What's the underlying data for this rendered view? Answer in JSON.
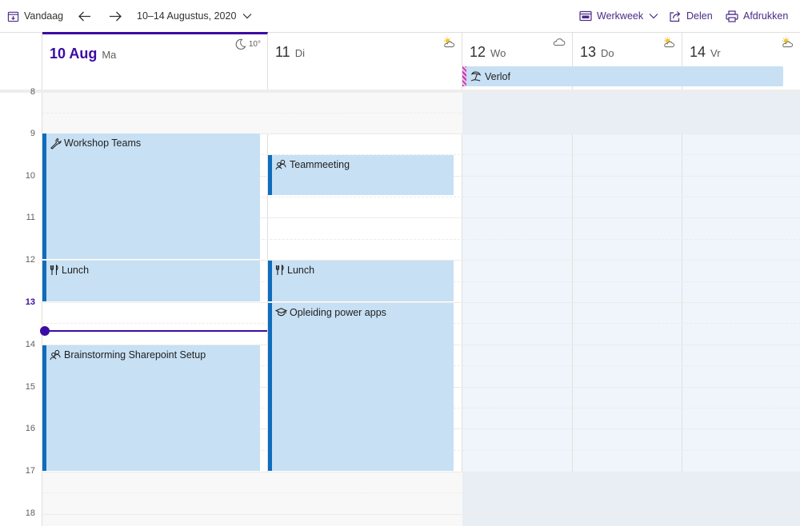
{
  "toolbar": {
    "today_label": "Vandaag",
    "date_range": "10–14 Augustus, 2020",
    "view_label": "Werkweek",
    "share_label": "Delen",
    "print_label": "Afdrukken"
  },
  "days": [
    {
      "num": "10 Aug",
      "name": "Ma",
      "weather_icon": "moon-icon",
      "temp": "10°"
    },
    {
      "num": "11",
      "name": "Di",
      "weather_icon": "partly-sunny-icon"
    },
    {
      "num": "12",
      "name": "Wo",
      "weather_icon": "cloud-icon"
    },
    {
      "num": "13",
      "name": "Do",
      "weather_icon": "partly-sunny-icon"
    },
    {
      "num": "14",
      "name": "Vr",
      "weather_icon": "partly-sunny-icon"
    }
  ],
  "allday_event": {
    "title": "Verlof",
    "icon": "beach-icon"
  },
  "hours": [
    "8",
    "9",
    "10",
    "11",
    "12",
    "13",
    "14",
    "15",
    "16",
    "17",
    "18"
  ],
  "events": {
    "workshop": {
      "title": "Workshop Teams",
      "icon": "wrench-icon"
    },
    "lunch_mon": {
      "title": "Lunch",
      "icon": "cutlery-icon"
    },
    "brainstorm": {
      "title": "Brainstorming Sharepoint Setup",
      "icon": "people-icon"
    },
    "teammeeting": {
      "title": "Teammeeting",
      "icon": "people-icon"
    },
    "lunch_tue": {
      "title": "Lunch",
      "icon": "cutlery-icon"
    },
    "opleiding": {
      "title": "Opleiding power apps",
      "icon": "graduation-cap-icon"
    }
  },
  "colors": {
    "accent": "#3a0ca3",
    "event_bg": "#c7e0f4",
    "event_bar": "#0f6cbd",
    "allday_stripe": "#c239b3"
  }
}
